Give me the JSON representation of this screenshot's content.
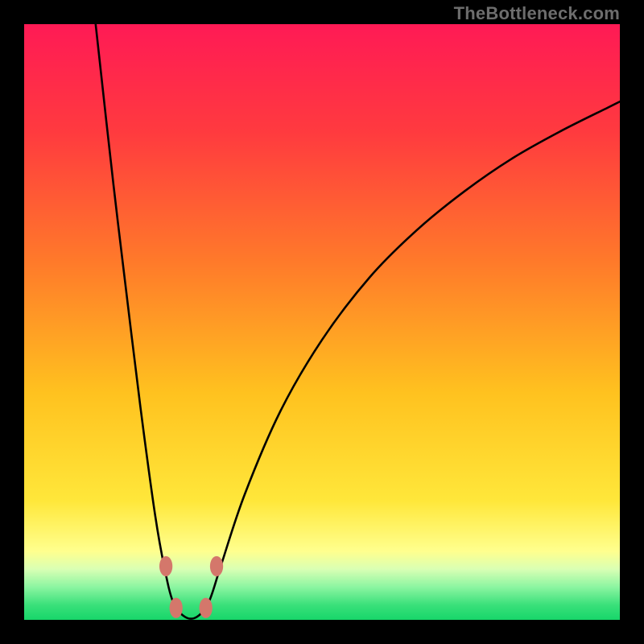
{
  "watermark": "TheBottleneck.com",
  "chart_data": {
    "type": "line",
    "title": "",
    "xlabel": "",
    "ylabel": "",
    "xlim": [
      0,
      100
    ],
    "ylim": [
      0,
      100
    ],
    "gradient_stops": [
      {
        "offset": 0,
        "color": "#ff1a55"
      },
      {
        "offset": 0.18,
        "color": "#ff3a3f"
      },
      {
        "offset": 0.4,
        "color": "#ff7a2a"
      },
      {
        "offset": 0.62,
        "color": "#ffc21f"
      },
      {
        "offset": 0.8,
        "color": "#ffe73a"
      },
      {
        "offset": 0.885,
        "color": "#ffff8e"
      },
      {
        "offset": 0.915,
        "color": "#d9ffb4"
      },
      {
        "offset": 0.945,
        "color": "#8bf5a1"
      },
      {
        "offset": 0.975,
        "color": "#3ae07a"
      },
      {
        "offset": 1.0,
        "color": "#17d66a"
      }
    ],
    "curve_points": [
      {
        "x": 12.0,
        "y": 100.0
      },
      {
        "x": 15.0,
        "y": 73.0
      },
      {
        "x": 18.0,
        "y": 48.0
      },
      {
        "x": 20.0,
        "y": 32.0
      },
      {
        "x": 22.0,
        "y": 17.5
      },
      {
        "x": 23.5,
        "y": 9.0
      },
      {
        "x": 25.0,
        "y": 3.0
      },
      {
        "x": 27.0,
        "y": 0.5
      },
      {
        "x": 29.0,
        "y": 0.5
      },
      {
        "x": 31.0,
        "y": 3.0
      },
      {
        "x": 33.0,
        "y": 9.0
      },
      {
        "x": 37.0,
        "y": 21.0
      },
      {
        "x": 43.0,
        "y": 35.0
      },
      {
        "x": 50.0,
        "y": 47.0
      },
      {
        "x": 58.0,
        "y": 57.5
      },
      {
        "x": 66.0,
        "y": 65.5
      },
      {
        "x": 74.0,
        "y": 72.0
      },
      {
        "x": 82.0,
        "y": 77.5
      },
      {
        "x": 90.0,
        "y": 82.0
      },
      {
        "x": 98.0,
        "y": 86.0
      },
      {
        "x": 100.0,
        "y": 87.0
      }
    ],
    "markers": [
      {
        "x": 23.8,
        "y": 9.0,
        "rx": 1.1,
        "ry": 1.7
      },
      {
        "x": 25.5,
        "y": 2.0,
        "rx": 1.1,
        "ry": 1.7
      },
      {
        "x": 30.5,
        "y": 2.0,
        "rx": 1.1,
        "ry": 1.7
      },
      {
        "x": 32.3,
        "y": 9.0,
        "rx": 1.1,
        "ry": 1.7
      }
    ]
  }
}
